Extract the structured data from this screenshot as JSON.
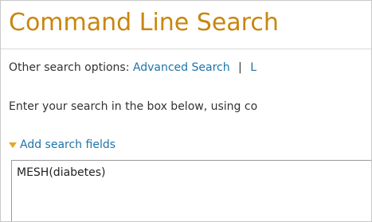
{
  "page": {
    "title": "Command Line Search"
  },
  "options": {
    "prefix": "Other search options:",
    "advanced_search": "Advanced Search",
    "separator": "|",
    "next_link": "L"
  },
  "instructions": "Enter your search in the box below, using co",
  "add_fields": {
    "label": "Add search fields",
    "icon": "triangle-down-icon"
  },
  "query": {
    "value": "MESH(diabetes)"
  },
  "colors": {
    "title": "#c9860e",
    "link": "#1d74a8",
    "triangle": "#e5a824",
    "text": "#333333"
  }
}
